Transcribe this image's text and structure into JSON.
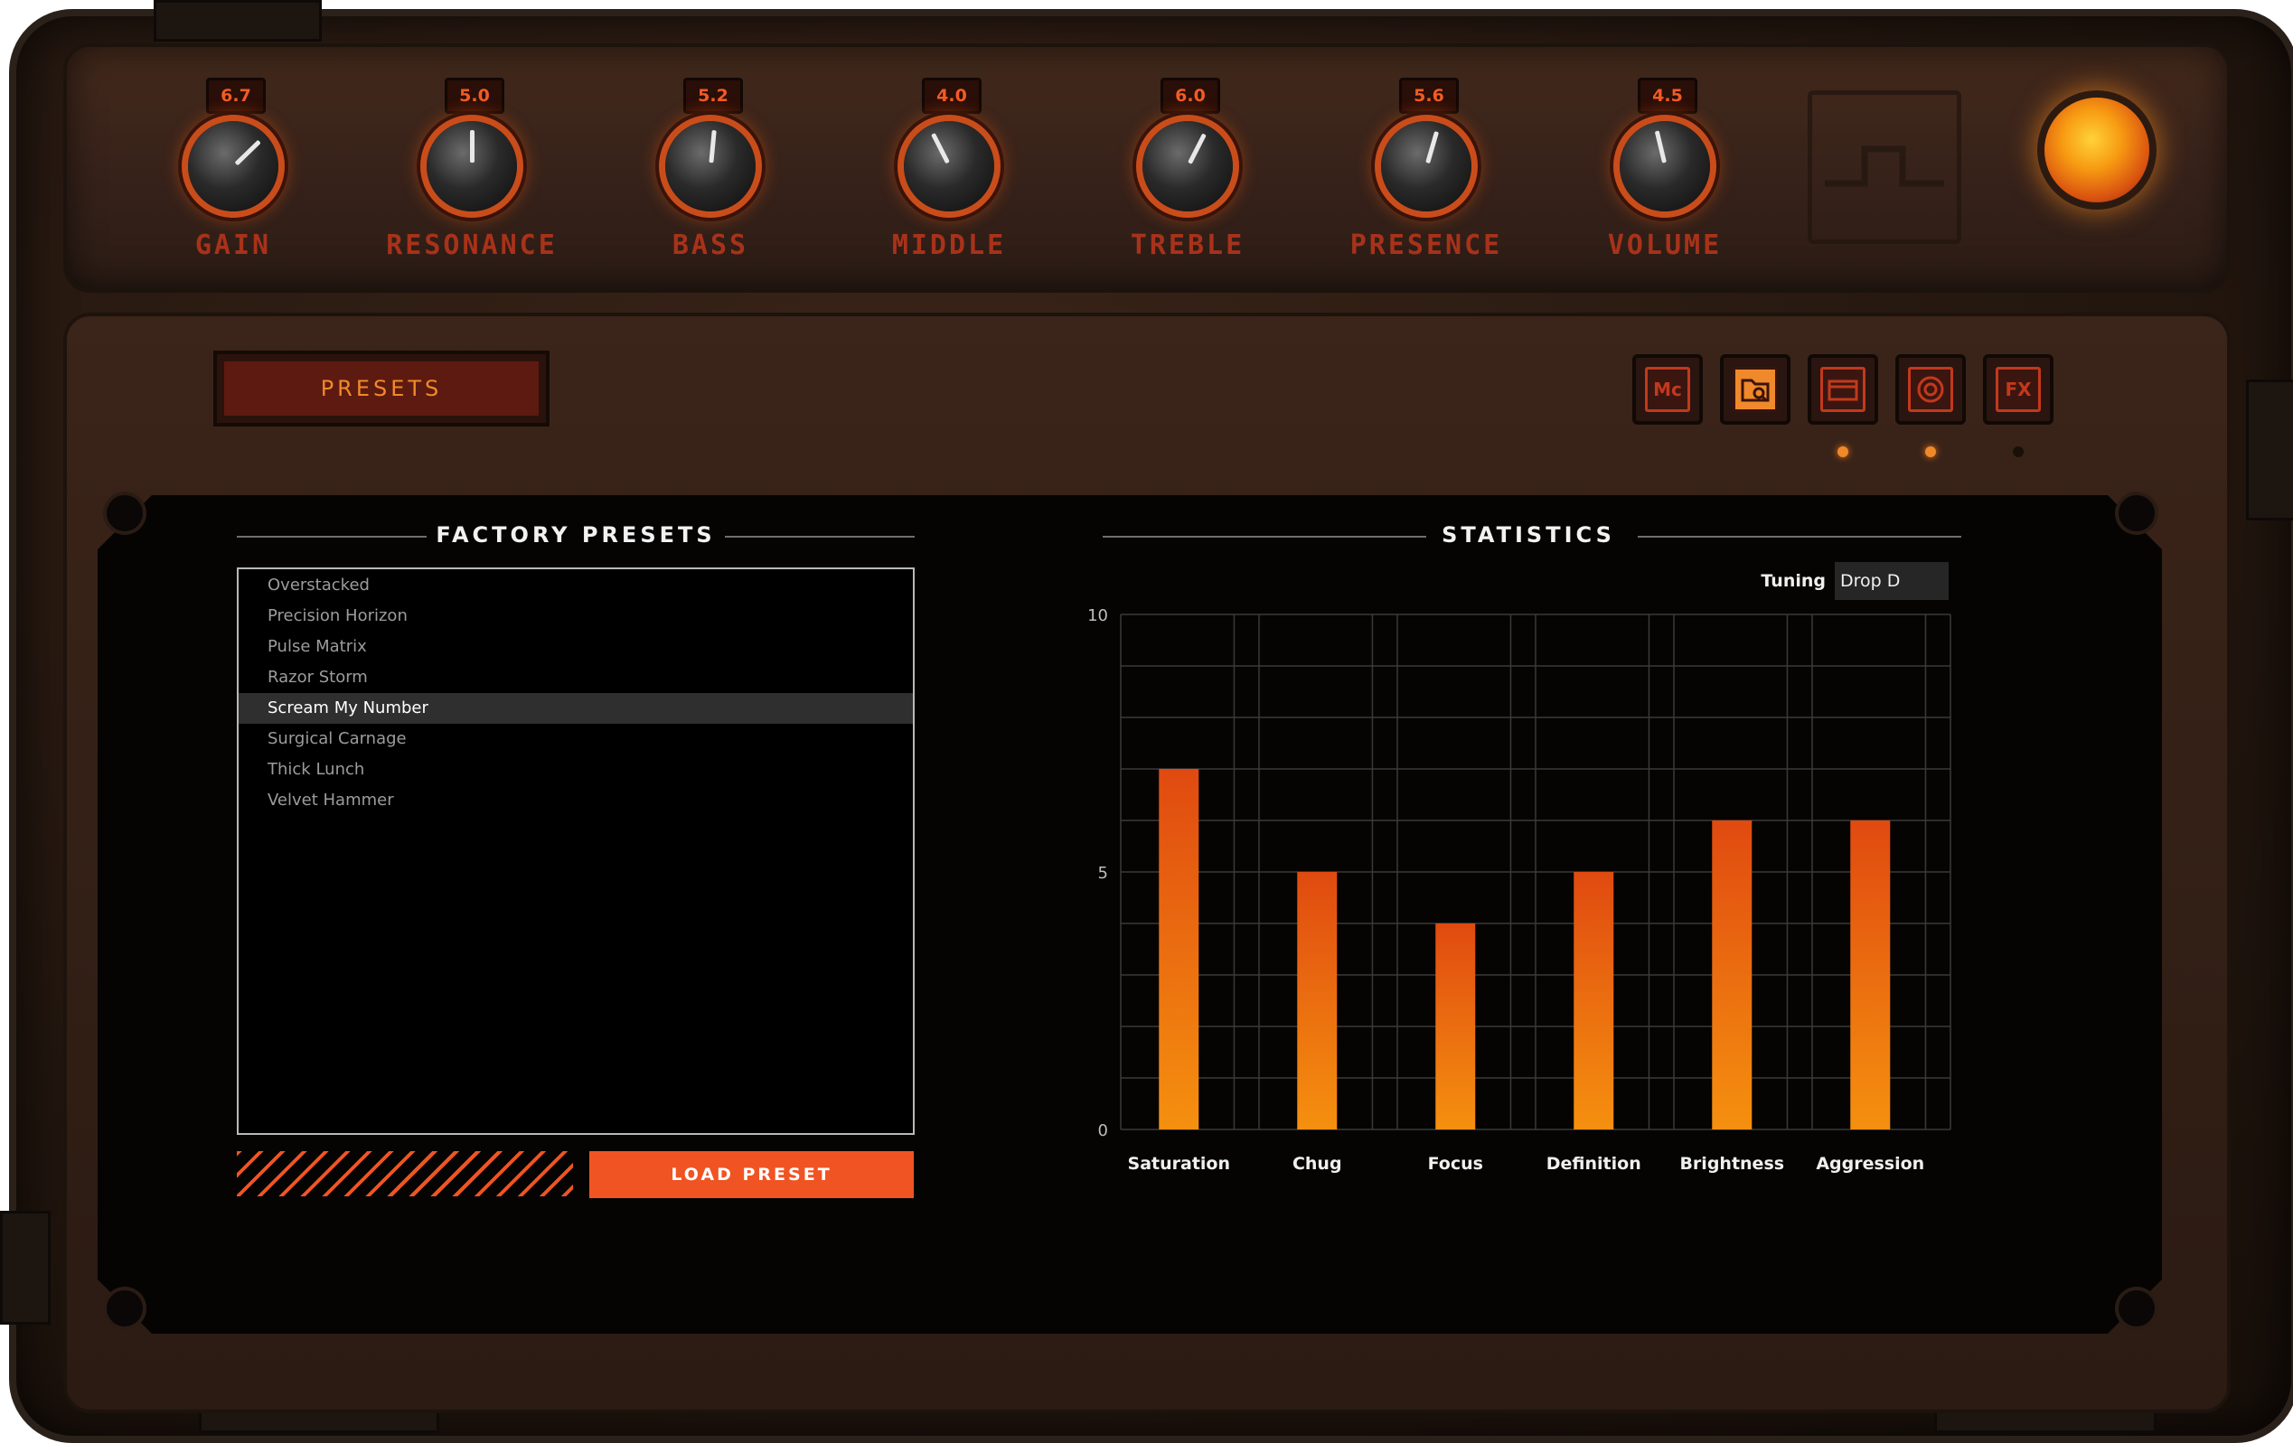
{
  "knobs": [
    {
      "label": "GAIN",
      "value": "6.7",
      "level": 0.67
    },
    {
      "label": "RESONANCE",
      "value": "5.0",
      "level": 0.5
    },
    {
      "label": "BASS",
      "value": "5.2",
      "level": 0.52
    },
    {
      "label": "MIDDLE",
      "value": "4.0",
      "level": 0.4
    },
    {
      "label": "TREBLE",
      "value": "6.0",
      "level": 0.6
    },
    {
      "label": "PRESENCE",
      "value": "5.6",
      "level": 0.56
    },
    {
      "label": "VOLUME",
      "value": "4.5",
      "level": 0.45
    }
  ],
  "presets_tab": {
    "label": "PRESETS"
  },
  "toolbar": {
    "buttons": [
      {
        "name": "mc-button",
        "label": "Mc",
        "icon": "mc-icon",
        "active": false,
        "led": "off"
      },
      {
        "name": "preset-browser-button",
        "label": "",
        "icon": "folder-search-icon",
        "active": true,
        "led": "on"
      },
      {
        "name": "cabinet-button",
        "label": "",
        "icon": "cabinet-icon",
        "active": false,
        "led": "off"
      },
      {
        "name": "speaker-button",
        "label": "",
        "icon": "speaker-icon",
        "active": false,
        "led": "on"
      },
      {
        "name": "fx-button",
        "label": "FX",
        "icon": "fx-icon",
        "active": false,
        "led": "dim"
      }
    ]
  },
  "factory_presets": {
    "title": "FACTORY PRESETS",
    "items": [
      "Overstacked",
      "Precision Horizon",
      "Pulse Matrix",
      "Razor Storm",
      "Scream My Number",
      "Surgical Carnage",
      "Thick Lunch",
      "Velvet Hammer"
    ],
    "selected": "Scream My Number",
    "load_label": "LOAD PRESET"
  },
  "statistics": {
    "title": "STATISTICS",
    "tuning_label": "Tuning",
    "tuning_value": "Drop D"
  },
  "chart_data": {
    "type": "bar",
    "categories": [
      "Saturation",
      "Chug",
      "Focus",
      "Definition",
      "Brightness",
      "Aggression"
    ],
    "values": [
      7,
      5,
      4,
      5,
      6,
      6
    ],
    "ylim": [
      0,
      10
    ],
    "yticks": [
      "0",
      "5",
      "10"
    ],
    "grid": true,
    "bar_gradient": [
      "#e04a10",
      "#f5900f"
    ]
  },
  "colors": {
    "accent": "#f05423",
    "led_on": "#f0892b",
    "panel": "#35211a"
  }
}
